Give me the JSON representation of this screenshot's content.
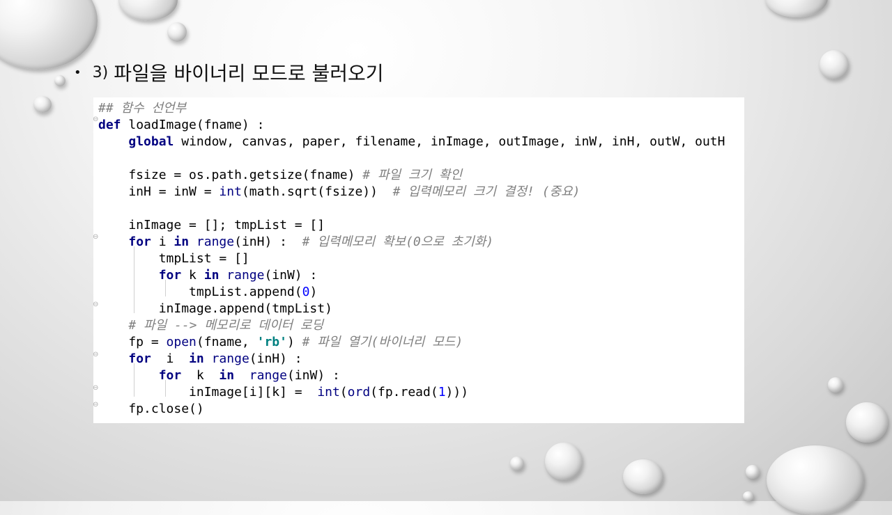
{
  "slide": {
    "bullet_char": "•",
    "number": "3)",
    "heading": "파일을 바이너리 모드로 불러오기"
  },
  "code": {
    "lines": [
      "## 함수 선언부",
      "def loadImage(fname) :",
      "    global window, canvas, paper, filename, inImage, outImage, inW, inH, outW, outH",
      "",
      "    fsize = os.path.getsize(fname) # 파일 크기 확인",
      "    inH = inW = int(math.sqrt(fsize))  # 입력메모리 크기 결정! (중요)",
      "",
      "    inImage = []; tmpList = []",
      "    for i in range(inH) :  # 입력메모리 확보(0으로 초기화)",
      "        tmpList = []",
      "        for k in range(inW) :",
      "            tmpList.append(0)",
      "        inImage.append(tmpList)",
      "    # 파일 --> 메모리로 데이터 로딩",
      "    fp = open(fname, 'rb') # 파일 열기(바이너리 모드)",
      "    for  i  in range(inH) :",
      "        for  k  in  range(inW) :",
      "            inImage[i][k] =  int(ord(fp.read(1)))",
      "    fp.close()"
    ]
  }
}
